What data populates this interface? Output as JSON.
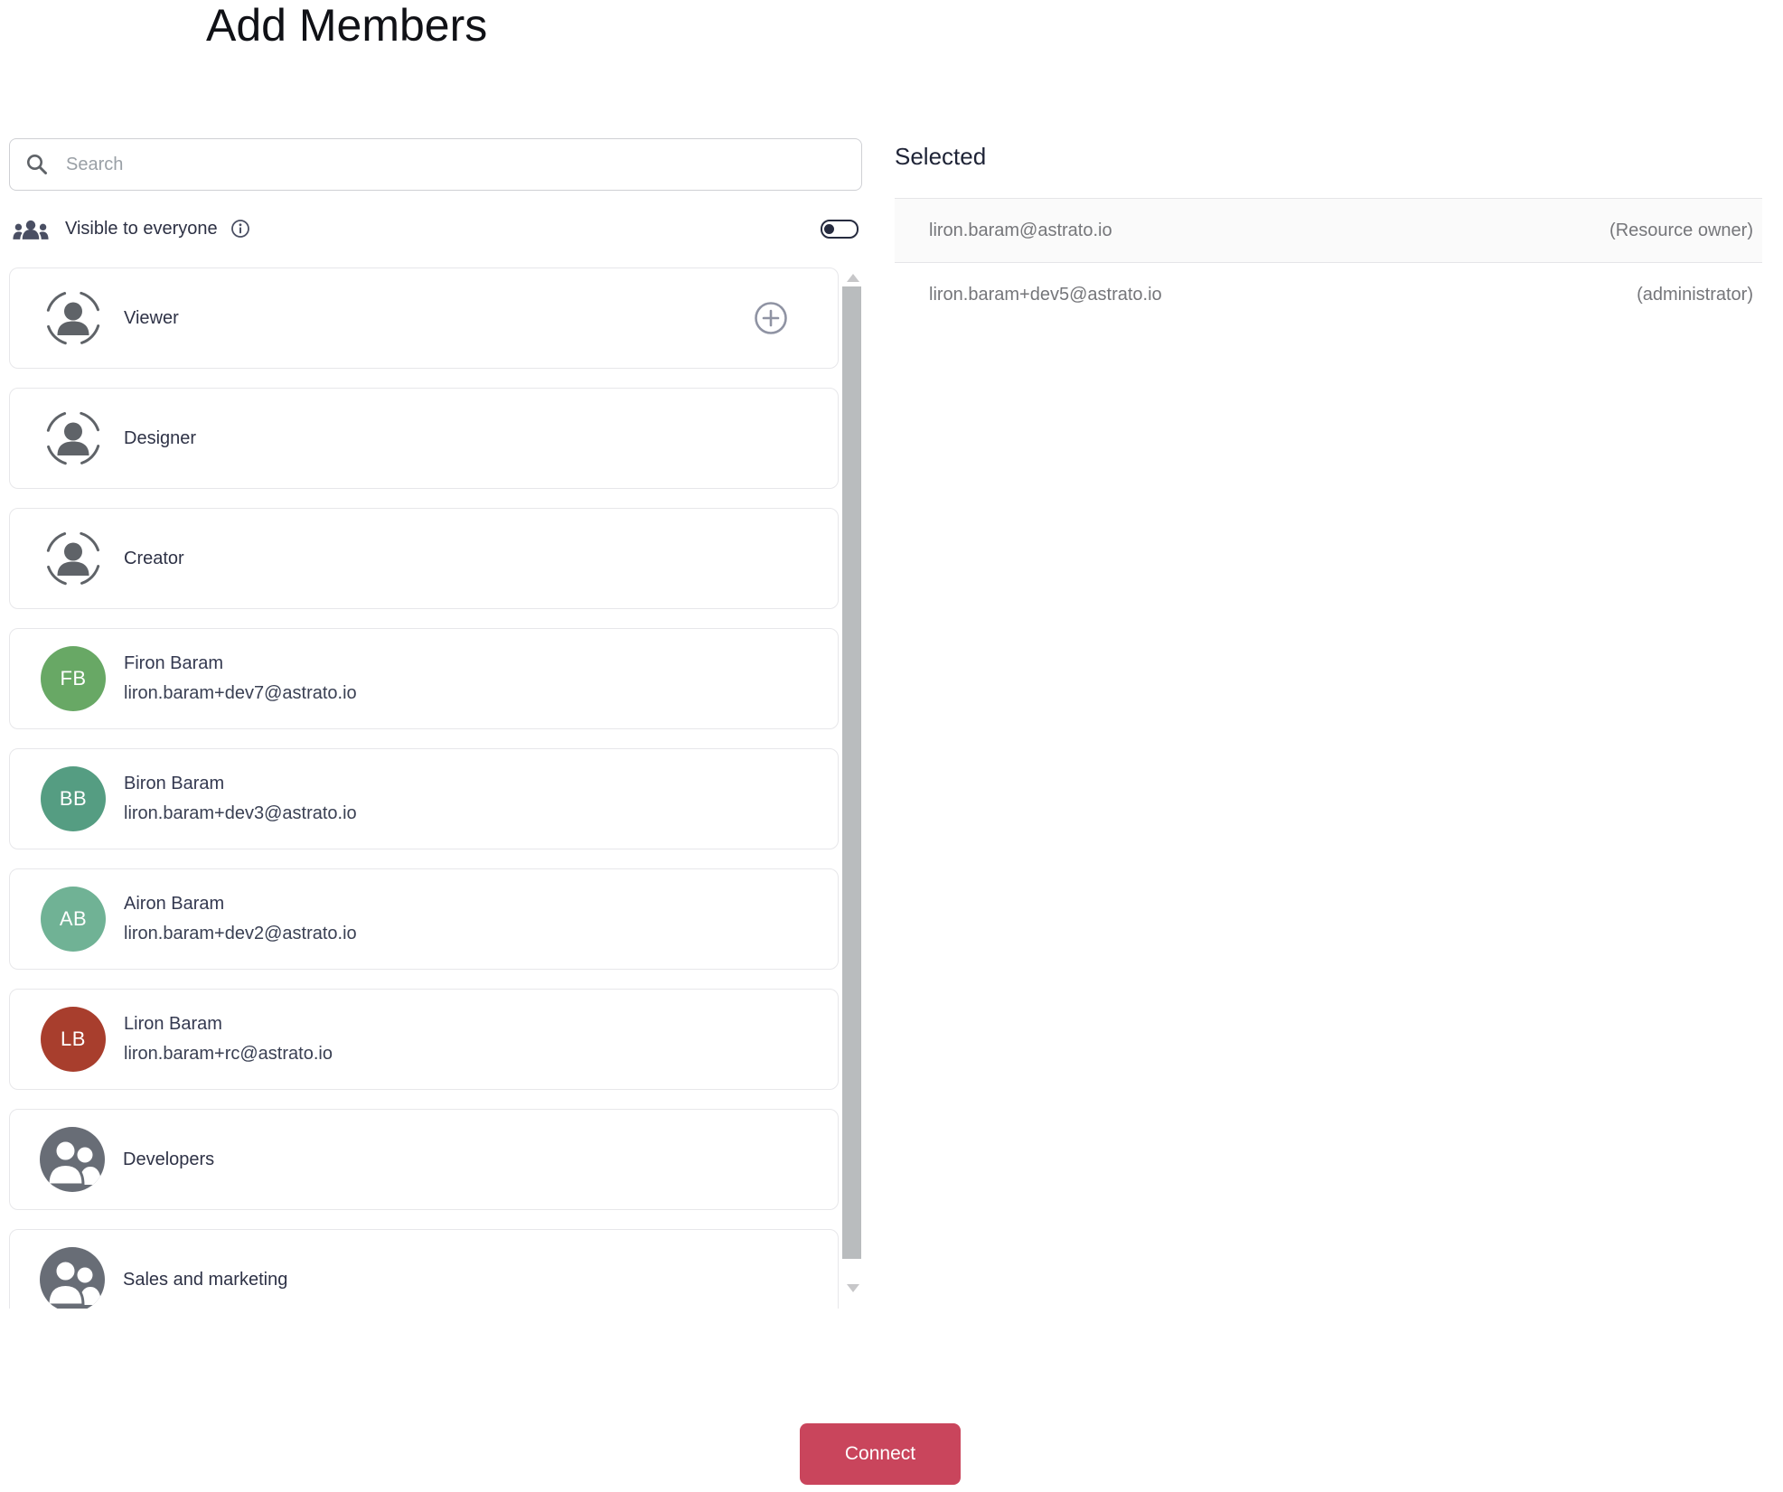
{
  "page": {
    "title": "Add Members"
  },
  "search": {
    "placeholder": "Search",
    "value": ""
  },
  "visibility": {
    "label": "Visible to everyone",
    "toggle_state": "off"
  },
  "list": {
    "items": [
      {
        "type": "role",
        "label": "Viewer",
        "has_add_button": true
      },
      {
        "type": "role",
        "label": "Designer"
      },
      {
        "type": "role",
        "label": "Creator"
      },
      {
        "type": "user",
        "name": "Firon Baram",
        "email": "liron.baram+dev7@astrato.io",
        "initials": "FB",
        "avatar_color": "#68a865"
      },
      {
        "type": "user",
        "name": "Biron Baram",
        "email": "liron.baram+dev3@astrato.io",
        "initials": "BB",
        "avatar_color": "#559d82"
      },
      {
        "type": "user",
        "name": "Airon Baram",
        "email": "liron.baram+dev2@astrato.io",
        "initials": "AB",
        "avatar_color": "#70b295"
      },
      {
        "type": "user",
        "name": "Liron Baram",
        "email": "liron.baram+rc@astrato.io",
        "initials": "LB",
        "avatar_color": "#a83e2d"
      },
      {
        "type": "group",
        "label": "Developers"
      },
      {
        "type": "group",
        "label": "Sales and marketing"
      }
    ]
  },
  "selected": {
    "heading": "Selected",
    "rows": [
      {
        "email": "liron.baram@astrato.io",
        "role": "(Resource owner)"
      },
      {
        "email": "liron.baram+dev5@astrato.io",
        "role": "(administrator)"
      }
    ]
  },
  "footer": {
    "connect_label": "Connect"
  },
  "colors": {
    "accent": "#c9455c",
    "group_avatar": "#686d76",
    "icon_gray": "#5f6368",
    "navy": "#262b3f"
  }
}
